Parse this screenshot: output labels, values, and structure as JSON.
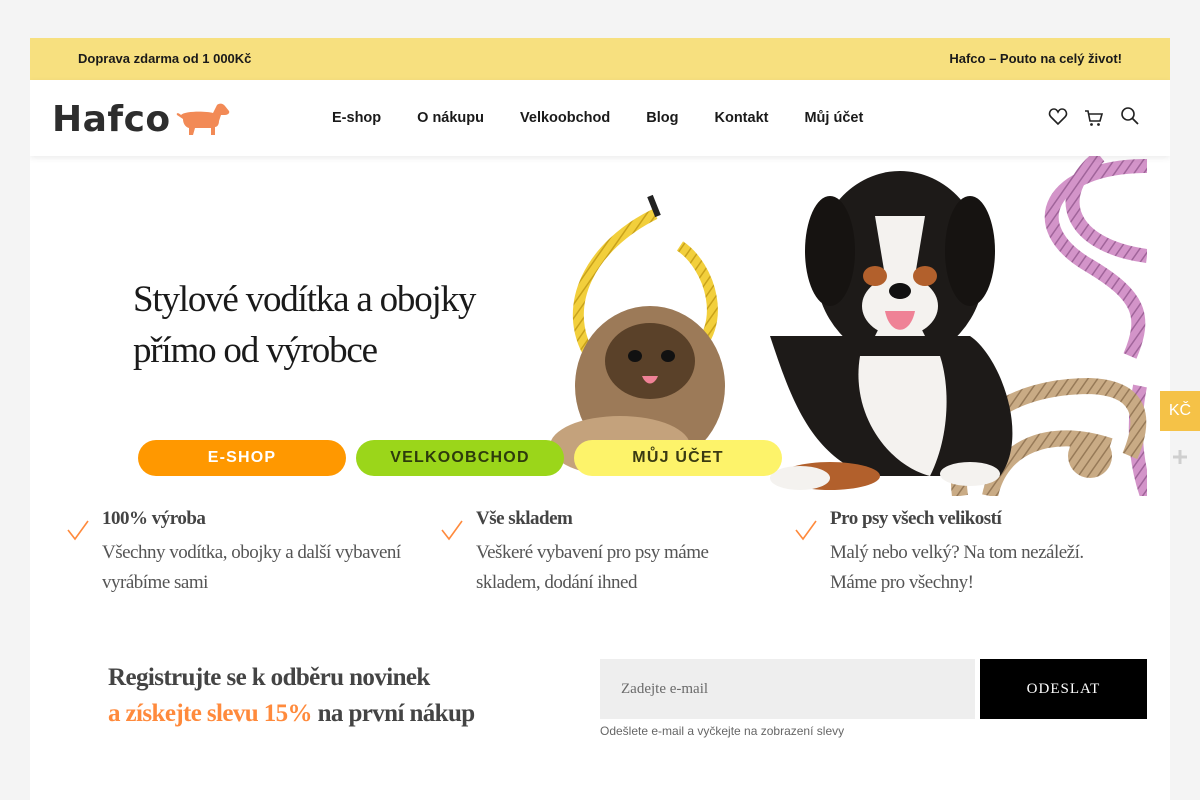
{
  "topbar": {
    "left_text": "Doprava zdarma od 1 000Kč",
    "right_text": "Hafco – Pouto na celý život!"
  },
  "header": {
    "logo_text": "Hafco",
    "nav": [
      "E-shop",
      "O nákupu",
      "Velkoobchod",
      "Blog",
      "Kontakt",
      "Můj účet"
    ],
    "icons": [
      "heart-icon",
      "cart-icon",
      "search-icon"
    ]
  },
  "hero": {
    "title_line1": "Stylové vodítka a obojky",
    "title_line2": "přímo od výrobce",
    "buttons": {
      "eshop": "E-SHOP",
      "velkoobchod": "VELKOOBCHOD",
      "ucet": "MŮJ ÚČET"
    }
  },
  "features": [
    {
      "title": "100% výroba",
      "text": "Všechny vodítka, obojky a další vybavení vyrábíme sami"
    },
    {
      "title": "Vše skladem",
      "text": "Veškeré vybavení pro psy máme skladem, dodání ihned"
    },
    {
      "title": "Pro psy všech velikostí",
      "text": "Malý nebo velký? Na tom nezáleží. Máme pro všechny!"
    }
  ],
  "newsletter": {
    "line1": "Registrujte se k odběru novinek",
    "accent": "a získejte slevu 15%",
    "line2_rest": " na první nákup",
    "placeholder": "Zadejte e-mail",
    "button": "ODESLAT",
    "hint": "Odešlete e-mail a vyčkejte na zobrazení slevy"
  },
  "side": {
    "currency": "KČ"
  },
  "colors": {
    "topbar": "#f7e07f",
    "eshop_button": "#ff9800",
    "velkoobchod_button": "#9bd61a",
    "ucet_button": "#fdf36a",
    "accent": "#ff8a3c"
  }
}
